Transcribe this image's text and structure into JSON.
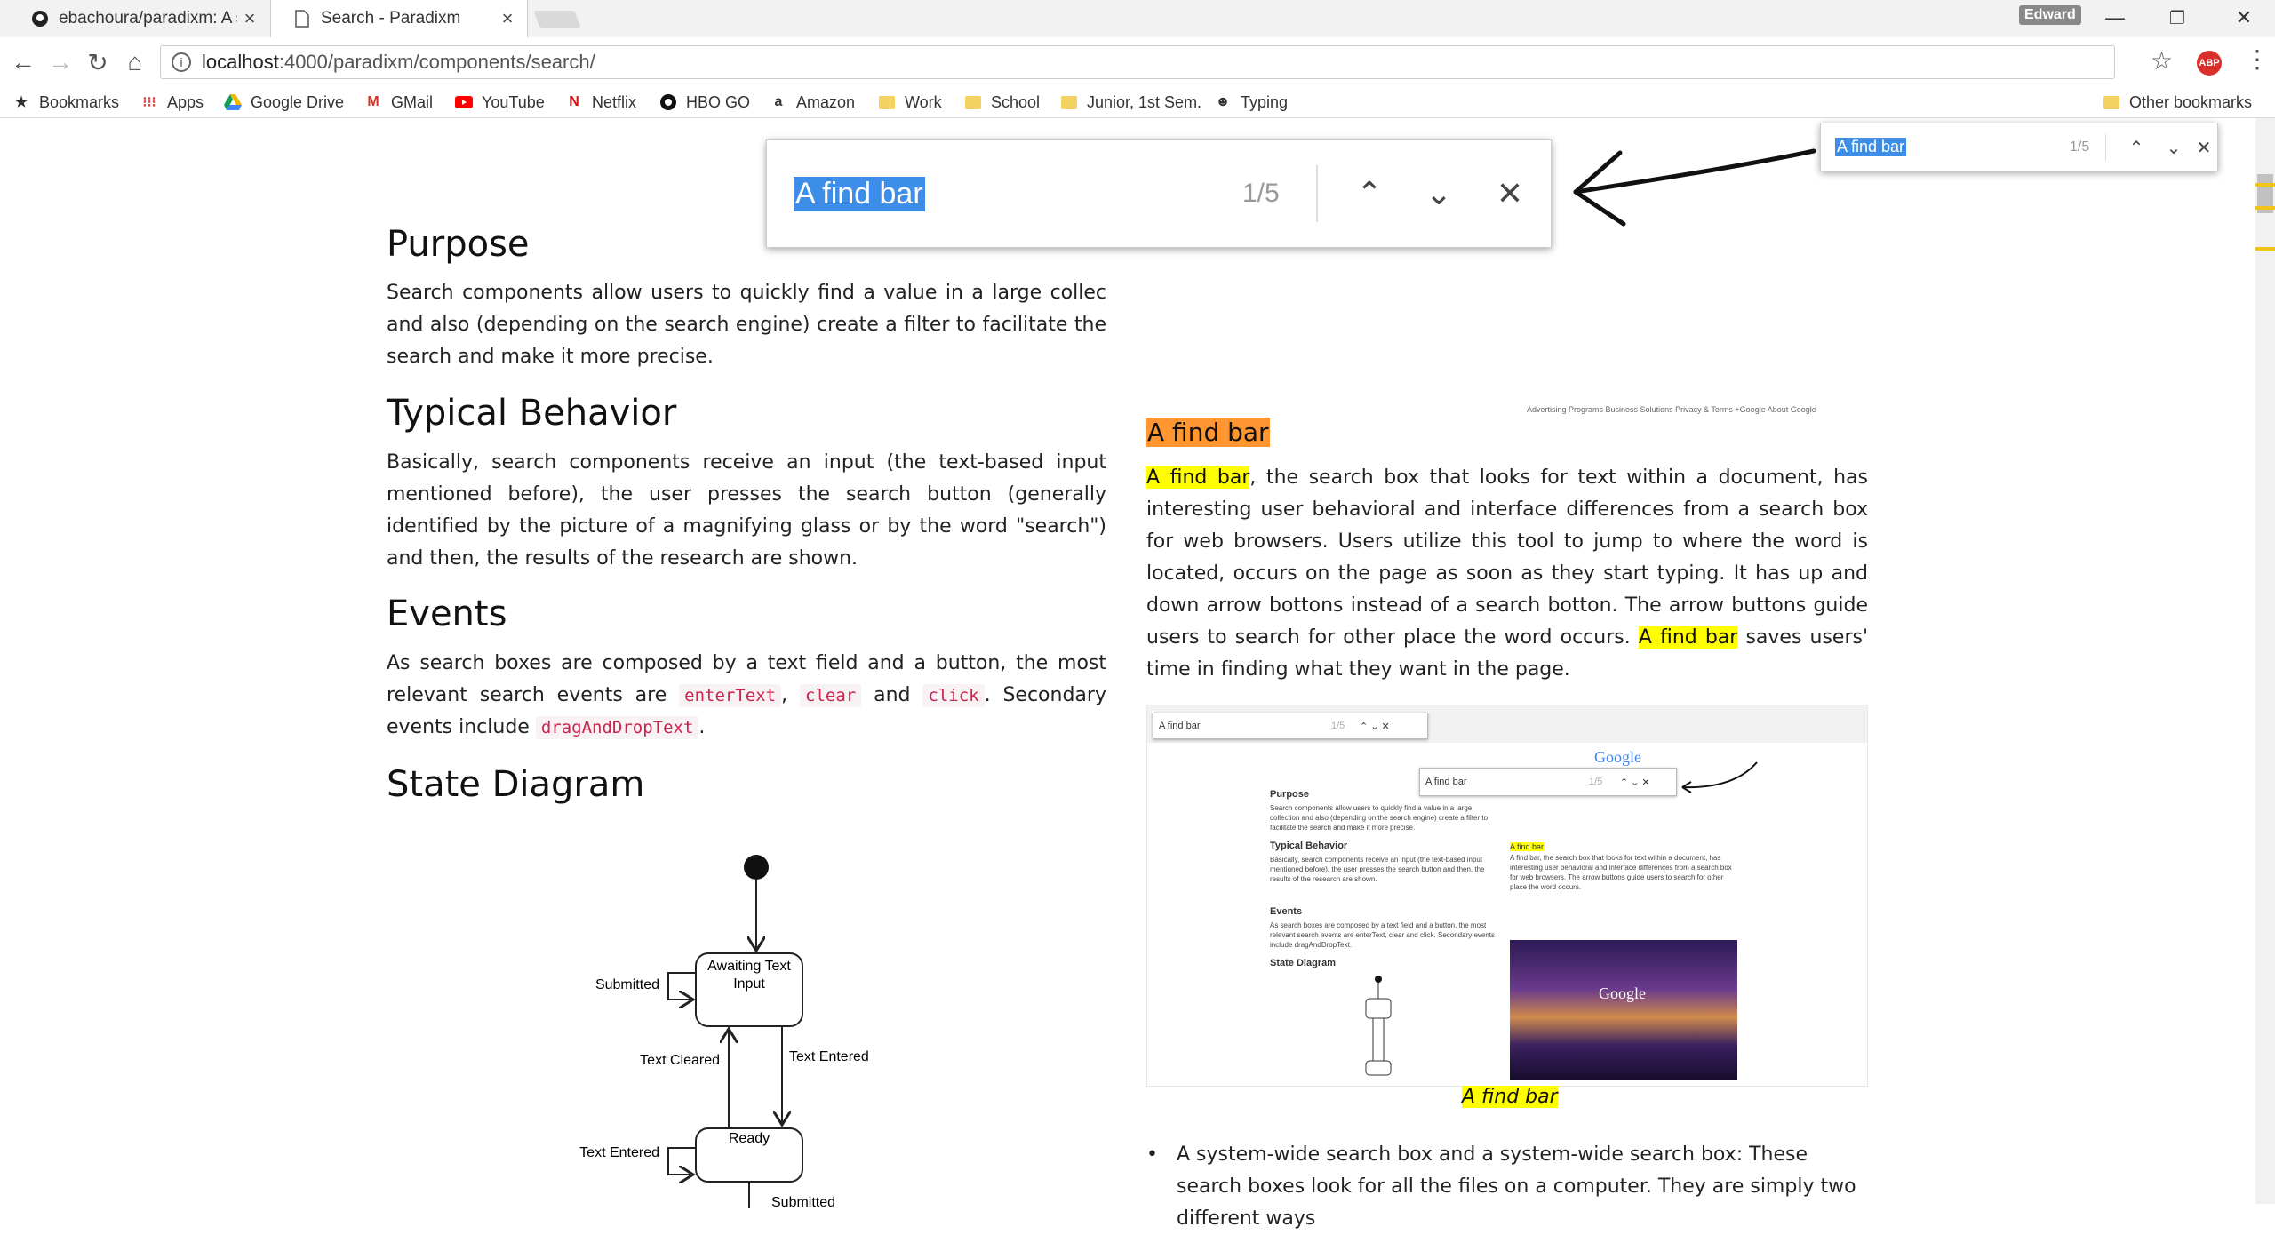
{
  "browser": {
    "tabs": [
      {
        "title": "ebachoura/paradixm: A s",
        "icon": "github-icon",
        "active": false
      },
      {
        "title": "Search - Paradixm",
        "icon": "page-icon",
        "active": true
      }
    ],
    "user": "Edward",
    "url_host": "localhost",
    "url_path": ":4000/paradixm/components/search/",
    "bookmarks": [
      {
        "label": "Bookmarks",
        "icon": "star-icon"
      },
      {
        "label": "Apps",
        "icon": "apps-grid-icon"
      },
      {
        "label": "Google Drive",
        "icon": "google-drive-icon"
      },
      {
        "label": "GMail",
        "icon": "gmail-icon"
      },
      {
        "label": "YouTube",
        "icon": "youtube-icon"
      },
      {
        "label": "Netflix",
        "icon": "netflix-icon"
      },
      {
        "label": "HBO GO",
        "icon": "hbo-icon"
      },
      {
        "label": "Amazon",
        "icon": "amazon-icon"
      },
      {
        "label": "Work",
        "icon": "folder-icon"
      },
      {
        "label": "School",
        "icon": "folder-icon"
      },
      {
        "label": "Junior, 1st Sem.",
        "icon": "folder-icon"
      },
      {
        "label": "Typing",
        "icon": "typing-icon"
      }
    ],
    "other_bookmarks": "Other bookmarks"
  },
  "find_bar_large": {
    "query": "A find bar",
    "count": "1/5"
  },
  "find_bar_small": {
    "query": "A find bar",
    "count": "1/5"
  },
  "left": {
    "purpose": {
      "heading": "Purpose",
      "text": "Search components allow users to quickly find a value in a large collec and also (depending on the search engine) create a filter to facilitate the search and make it more precise."
    },
    "behavior": {
      "heading": "Typical Behavior",
      "text": "Basically, search components receive an input (the text-based input mentioned before), the user presses the search button (generally identified by the picture of a magnifying glass or by the word \"search\") and then, the results of the research are shown."
    },
    "events": {
      "heading": "Events",
      "text_1": "As search boxes are composed by a text field and a button, the most relevant search events are",
      "code_1": "enterText",
      "sep_1": ",",
      "code_2": "clear",
      "and": "and",
      "code_3": "click",
      "text_2": ". Secondary events include",
      "code_4": "dragAndDropText",
      "text_3": "."
    },
    "state_diagram": {
      "heading": "State Diagram",
      "states": [
        "Awaiting Text Input",
        "Ready"
      ],
      "transitions": [
        "Submitted",
        "Text Cleared",
        "Text Entered",
        "Text Entered",
        "Submitted"
      ]
    }
  },
  "right": {
    "heading": "A find bar",
    "p_mark": "A find bar",
    "p_1": ", the search box that looks for text within a document, has interesting user behavioral and interface differences from a search box for web browsers. Users utilize this tool to jump to where the word is located, occurs on the page as soon as they start typing. It has up and down arrow bottons instead of a search botton. The arrow buttons guide users to search for other place the word occurs.",
    "p_mark_2": "A find bar",
    "p_2": "saves users' time in finding what they want in the page.",
    "google_links": "Advertising Programs    Business Solutions    Privacy & Terms    +Google    About Google",
    "caption": "A find bar",
    "bullet": "A system-wide search box and a system-wide search box: These search boxes look for all the files on a computer. They are simply two different ways"
  },
  "thumbnail": {
    "find_query": "A find bar",
    "find_count": "1/5",
    "google": "Google",
    "headings": [
      "Purpose",
      "Typical Behavior",
      "Events",
      "State Diagram",
      "A find bar"
    ]
  },
  "colors": {
    "find_highlight": "#ffff00",
    "find_current": "#ff9632",
    "selection": "#3d8ee8",
    "code_text": "#c7254e"
  }
}
